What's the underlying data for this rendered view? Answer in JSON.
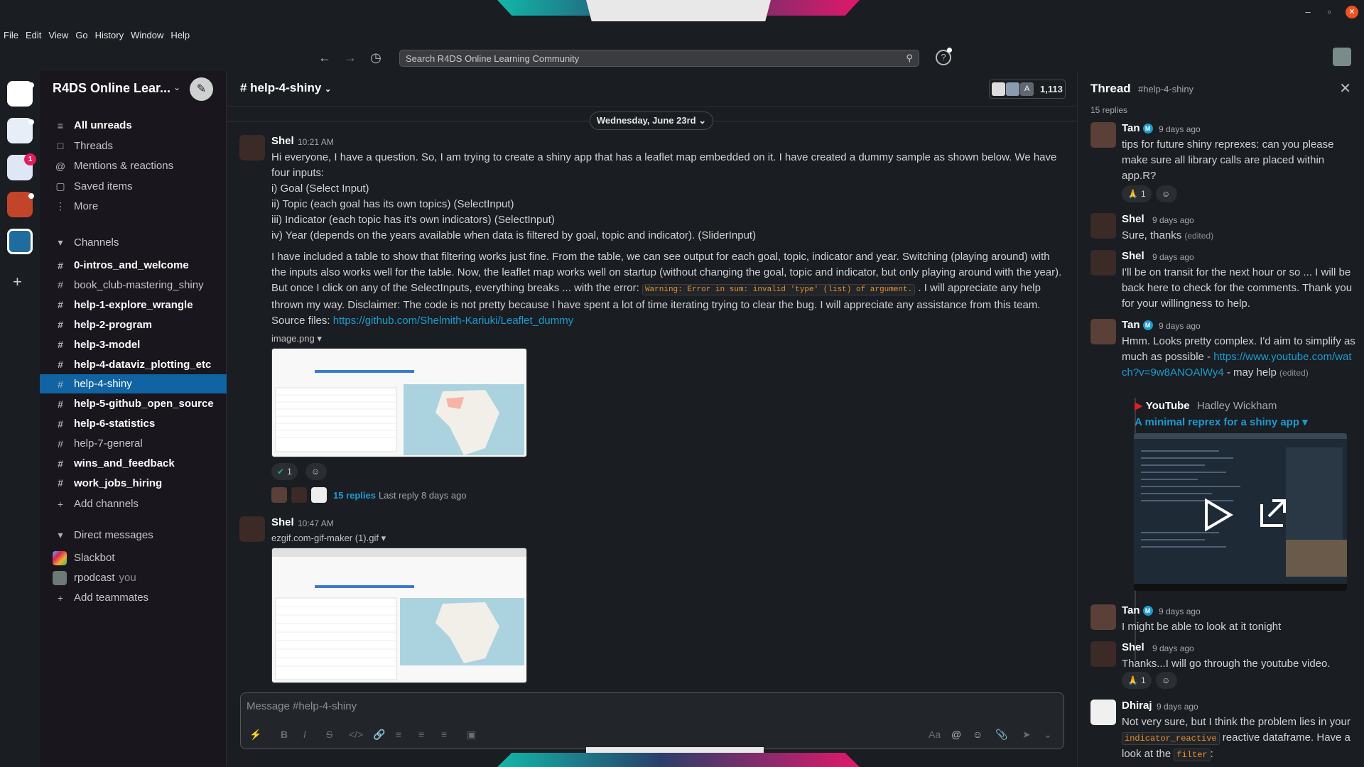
{
  "window": {
    "minimize": "–",
    "maximize": "▫",
    "close": "✕"
  },
  "menu": [
    "File",
    "Edit",
    "View",
    "Go",
    "History",
    "Window",
    "Help"
  ],
  "search": {
    "placeholder": "Search R4DS Online Learning Community"
  },
  "workspace": {
    "name": "R4DS Online Lear...",
    "badge": "1"
  },
  "sidebar": {
    "nav": [
      {
        "label": "All unreads",
        "icon": "unreads-icon",
        "bold": true
      },
      {
        "label": "Threads",
        "icon": "threads-icon",
        "bold": false
      },
      {
        "label": "Mentions & reactions",
        "icon": "mention-icon",
        "bold": false
      },
      {
        "label": "Saved items",
        "icon": "bookmark-icon",
        "bold": false
      },
      {
        "label": "More",
        "icon": "more-icon",
        "bold": false
      }
    ],
    "channels_header": "Channels",
    "channels": [
      {
        "name": "0-intros_and_welcome",
        "bold": true
      },
      {
        "name": "book_club-mastering_shiny",
        "bold": false
      },
      {
        "name": "help-1-explore_wrangle",
        "bold": true
      },
      {
        "name": "help-2-program",
        "bold": true
      },
      {
        "name": "help-3-model",
        "bold": true
      },
      {
        "name": "help-4-dataviz_plotting_etc",
        "bold": true
      },
      {
        "name": "help-4-shiny",
        "bold": false,
        "active": true
      },
      {
        "name": "help-5-github_open_source",
        "bold": true
      },
      {
        "name": "help-6-statistics",
        "bold": true
      },
      {
        "name": "help-7-general",
        "bold": false
      },
      {
        "name": "wins_and_feedback",
        "bold": true
      },
      {
        "name": "work_jobs_hiring",
        "bold": true
      }
    ],
    "add_channels": "Add channels",
    "dm_header": "Direct messages",
    "dms": [
      {
        "name": "Slackbot",
        "you": ""
      },
      {
        "name": "rpodcast",
        "you": "you"
      }
    ],
    "add_teammates": "Add teammates"
  },
  "channel": {
    "title": "# help-4-shiny",
    "member_count": "1,113",
    "member_initial": "A"
  },
  "date_divider": "Wednesday, June 23rd",
  "messages": [
    {
      "author": "Shel",
      "time": "10:21 AM",
      "lines": [
        "Hi everyone, I have a question. So, I am trying to create a shiny app that has a leaflet map embedded on it. I have created a dummy sample as shown below. We have four inputs:",
        "i) Goal (Select Input)",
        "ii) Topic (each goal has its own topics) (SelectInput)",
        "iii) Indicator (each topic has it's own indicators) (SelectInput)",
        "iv) Year (depends on the years available when data is filtered by goal, topic and indicator). (SliderInput)"
      ],
      "para2_a": "I have included a table to show that filtering works just fine. From the table, we can see output for each goal, topic, indicator and year. Switching (playing around) with the inputs also works well for the table. Now, the leaflet map works well on startup (without changing the goal, topic and indicator, but only playing around with the year). But once I click on any of the SelectInputs, everything breaks ... with the error:",
      "error_code": "Warning: Error in sum: invalid 'type' (list) of argument.",
      "para2_b": ". I will appreciate any help thrown my way. Disclaimer: The code is not pretty because I have spent a lot of time iterating trying to clear the bug. I will appreciate any assistance from this team.",
      "source_label": "Source files:",
      "source_link": "https://github.com/Shelmith-Kariuki/Leaflet_dummy",
      "file": "image.png",
      "reaction_count": "1",
      "replies": "15 replies",
      "last_reply": "Last reply 8 days ago"
    },
    {
      "author": "Shel",
      "time": "10:47 AM",
      "file": "ezgif.com-gif-maker (1).gif"
    }
  ],
  "composer": {
    "placeholder": "Message #help-4-shiny",
    "aa": "Aa"
  },
  "thread": {
    "title": "Thread",
    "channel": "#help-4-shiny",
    "replies": "15 replies",
    "items": [
      {
        "author": "Tan",
        "time": "9 days ago",
        "text": "tips for future shiny reprexes: can you please make sure all library calls are placed within app.R?",
        "reaction": "1"
      },
      {
        "author": "Shel",
        "time": "9 days ago",
        "text": "Sure, thanks",
        "edited": "(edited)"
      },
      {
        "author": "Shel",
        "time": "9 days ago",
        "text": "I'll be on transit for the next hour or so ... I will be back here to check for the comments. Thank you for your willingness to help."
      },
      {
        "author": "Tan",
        "time": "9 days ago",
        "text": "Hmm. Looks pretty complex. I'd aim to simplify as much as possible -",
        "link": "https://www.youtube.com/watch?v=9w8ANOAlWy4",
        "after": " - may help",
        "edited": "(edited)"
      },
      {
        "author": "Tan",
        "time": "9 days ago",
        "text": "I might be able to look at it tonight"
      },
      {
        "author": "Shel",
        "time": "9 days ago",
        "text": "Thanks...I will go through the youtube video.",
        "reaction": "1"
      },
      {
        "author": "Dhiraj",
        "time": "9 days ago",
        "text_a": "Not very sure, but I think the problem lies in your",
        "code": "indicator_reactive",
        "text_b": "reactive dataframe. Have a look at the",
        "code2": "filter",
        "text_c": ":"
      }
    ],
    "youtube": {
      "source": "YouTube",
      "channel": "Hadley Wickham",
      "title": "A minimal reprex for a shiny app"
    }
  }
}
